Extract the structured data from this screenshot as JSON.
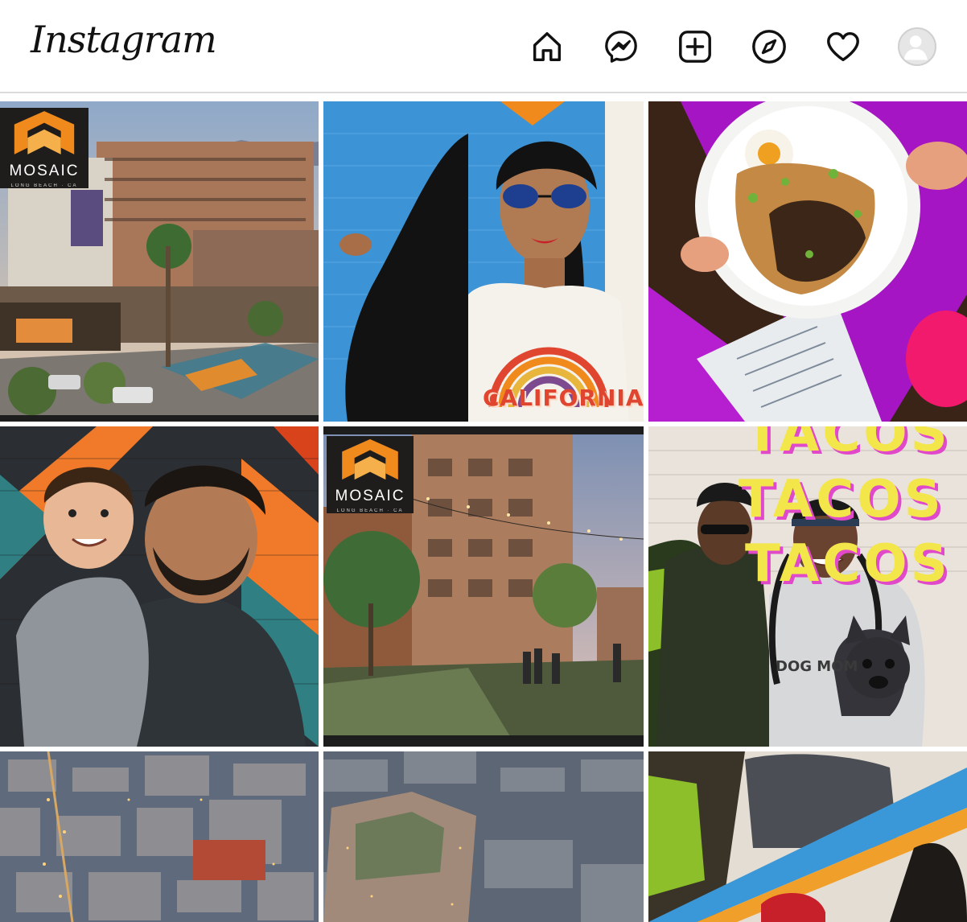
{
  "app": {
    "logo_text": "Instagram"
  },
  "nav": {
    "icons": [
      "home-icon",
      "messenger-icon",
      "new-post-icon",
      "explore-icon",
      "activity-heart-icon",
      "profile-avatar"
    ]
  },
  "posts": {
    "p0": {
      "brand_name": "MOSAIC",
      "brand_sub": "LONG BEACH · CA"
    },
    "p1": {
      "shirt_text": "CALIFORNIA"
    },
    "p4": {
      "brand_name": "MOSAIC",
      "brand_sub": "LONG BEACH · CA"
    },
    "p5": {
      "mural_line_1": "TACOS",
      "mural_line_2": "TACOS",
      "mural_line_3": "TACOS",
      "shirt_text": "DOG MOM"
    }
  },
  "colors": {
    "brand_orange": "#f08a1c",
    "mural_yellow": "#f3e64a",
    "mural_pink": "#e049c9",
    "sky_blue": "#3c94d6"
  }
}
